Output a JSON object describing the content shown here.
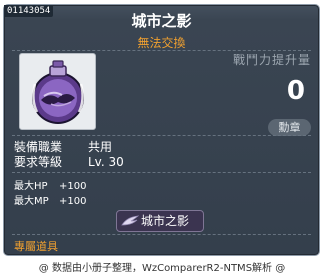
{
  "item_id": "01143054",
  "title": "城市之影",
  "subtitle": "無法交換",
  "power": {
    "label": "戰鬥力提升量",
    "value": "0"
  },
  "medal_button": "勳章",
  "job": {
    "label": "裝備職業",
    "value": "共用"
  },
  "level": {
    "label": "要求等級",
    "value": "Lv. 30"
  },
  "stats": [
    {
      "label": "最大HP",
      "value": "+100"
    },
    {
      "label": "最大MP",
      "value": "+100"
    }
  ],
  "tag_label": "城市之影",
  "exclusive": "專屬道具",
  "footer": "@ 数据由小册子整理，WzComparerR2-NTMS解析 @",
  "icon": "purple-city-medal-icon",
  "colors": {
    "background": "#343f4c",
    "accent_orange": "#f0a030",
    "text": "#ffffff",
    "muted": "#9ca6b0"
  }
}
